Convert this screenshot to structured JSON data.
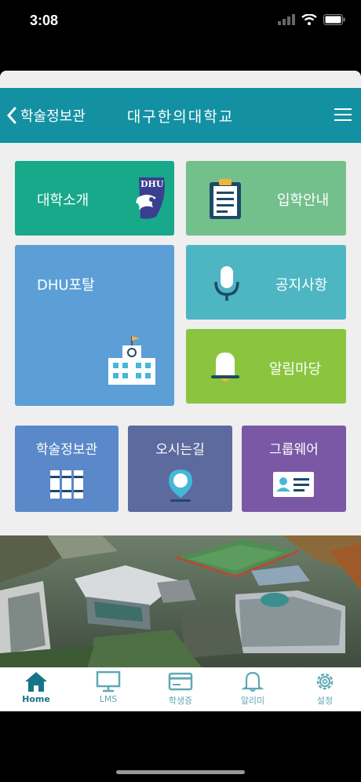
{
  "status": {
    "time": "3:08"
  },
  "appbar": {
    "back_label": "학술정보관",
    "title": "대구한의대학교"
  },
  "tiles": {
    "about": "대학소개",
    "admission": "입학안내",
    "portal": "DHU포탈",
    "notice": "공지사항",
    "alerts": "알림마당",
    "library": "학술정보관",
    "directions": "오시는길",
    "groupware": "그룹웨어"
  },
  "logo_text": "DHU",
  "tabs": [
    "Home",
    "LMS",
    "학생증",
    "알리미",
    "설정"
  ],
  "colors": {
    "appbar": "#1391a3",
    "about": "#17a98a",
    "admission": "#73c08d",
    "portal": "#5b9fd6",
    "notice": "#4db6c2",
    "alerts": "#8bc53f",
    "library": "#5b88c8",
    "directions": "#5c6a9e",
    "groupware": "#7b58a6"
  }
}
